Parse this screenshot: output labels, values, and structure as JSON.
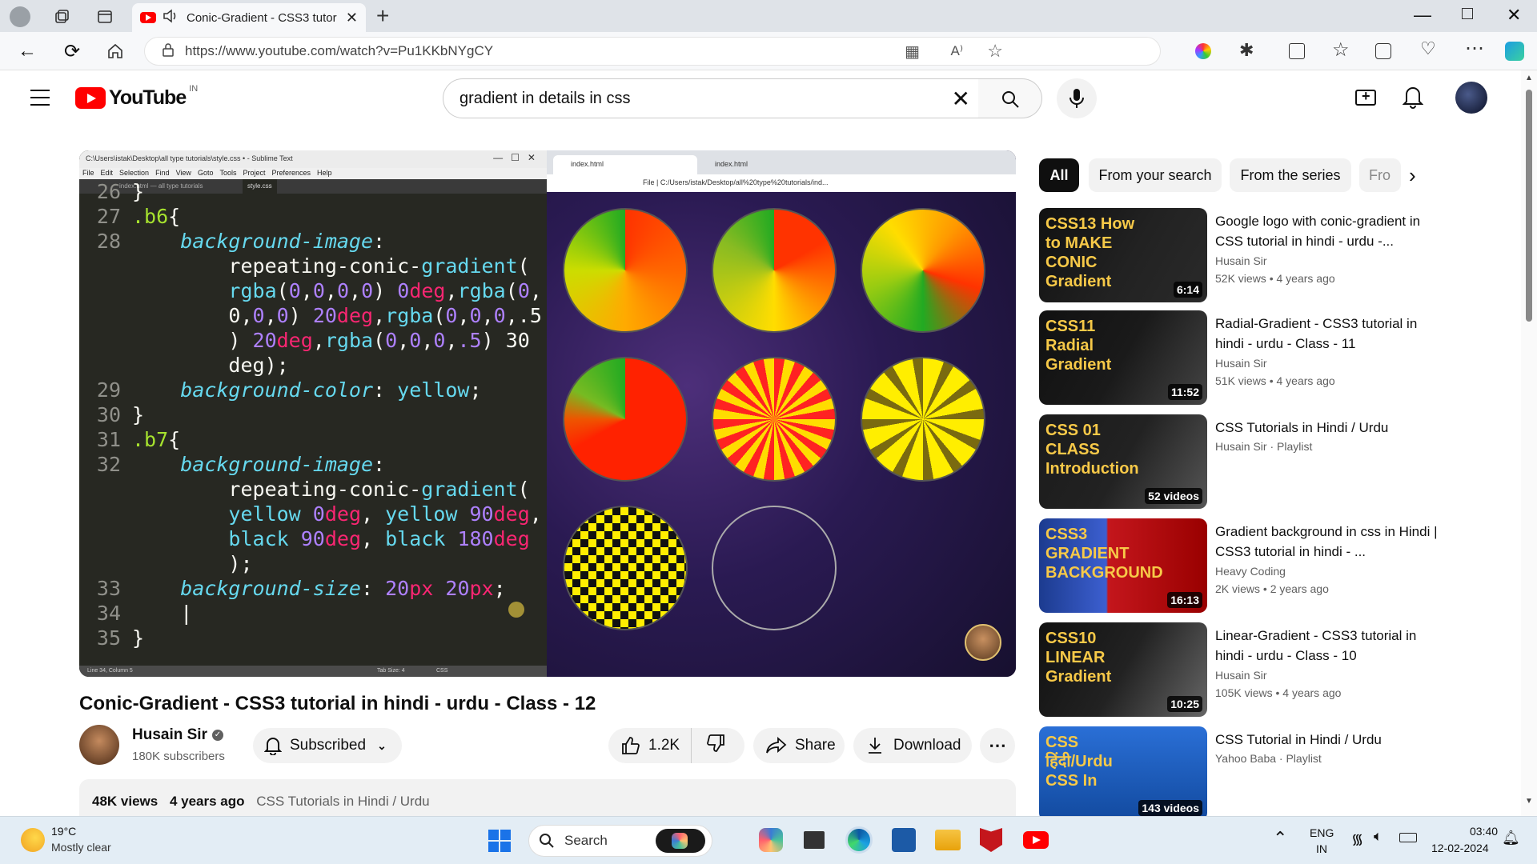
{
  "browser": {
    "tab_title": "Conic-Gradient - CSS3 tutor",
    "url": "https://www.youtube.com/watch?v=Pu1KKbNYgCY"
  },
  "youtube": {
    "logo_text": "YouTube",
    "region": "IN",
    "search_query": "gradient in details in css"
  },
  "editor": {
    "window_title": "C:\\Users\\istak\\Desktop\\all type tutorials\\style.css • - Sublime Text",
    "menu": [
      "File",
      "Edit",
      "Selection",
      "Find",
      "View",
      "Goto",
      "Tools",
      "Project",
      "Preferences",
      "Help"
    ],
    "tabs": [
      "index.html — all type tutorials",
      "style.css"
    ],
    "status_left": "Line 34, Column 5",
    "status_right": "Tab Size: 4",
    "status_lang": "CSS",
    "lines": [
      {
        "n": "26",
        "t": "}"
      },
      {
        "n": "27",
        "t": ".b6{"
      },
      {
        "n": "28",
        "t": "    background-image:"
      },
      {
        "n": "",
        "t": "        repeating-conic-gradient("
      },
      {
        "n": "",
        "t": "        rgba(0,0,0,0) 0deg,rgba(0,"
      },
      {
        "n": "",
        "t": "        0,0,0) 20deg,rgba(0,0,0,.5"
      },
      {
        "n": "",
        "t": "        ) 20deg,rgba(0,0,0,.5) 30"
      },
      {
        "n": "",
        "t": "        deg);"
      },
      {
        "n": "29",
        "t": "    background-color: yellow;"
      },
      {
        "n": "30",
        "t": "}"
      },
      {
        "n": "31",
        "t": ".b7{"
      },
      {
        "n": "32",
        "t": "    background-image:"
      },
      {
        "n": "",
        "t": "        repeating-conic-gradient("
      },
      {
        "n": "",
        "t": "        yellow 0deg, yellow 90deg,"
      },
      {
        "n": "",
        "t": "        black 90deg, black 180deg"
      },
      {
        "n": "",
        "t": "        );"
      },
      {
        "n": "33",
        "t": "    background-size: 20px 20px;"
      },
      {
        "n": "34",
        "t": "    |"
      },
      {
        "n": "35",
        "t": "}"
      }
    ]
  },
  "inner_browser": {
    "tab1": "index.html",
    "tab2": "index.html",
    "url": "C:/Users/istak/Desktop/all%20type%20tutorials/ind...",
    "file_label": "File"
  },
  "video": {
    "title": "Conic-Gradient - CSS3 tutorial in hindi - urdu - Class - 12",
    "channel": "Husain Sir",
    "subscribers": "180K subscribers",
    "subscribe_label": "Subscribed",
    "likes": "1.2K",
    "share_label": "Share",
    "download_label": "Download",
    "views": "48K views",
    "age": "4 years ago",
    "playlist_link": "CSS Tutorials in Hindi / Urdu"
  },
  "chips": [
    "All",
    "From your search",
    "From the series",
    "Fro"
  ],
  "recommendations": [
    {
      "title": "Google logo with conic-gradient in CSS tutorial in hindi - urdu -...",
      "channel": "Husain Sir",
      "meta": "52K views • 4 years ago",
      "duration": "6:14",
      "thumb_text": "CSS13 How to MAKE CONIC Gradient"
    },
    {
      "title": "Radial-Gradient - CSS3 tutorial in hindi - urdu - Class - 11",
      "channel": "Husain Sir",
      "meta": "51K views • 4 years ago",
      "duration": "11:52",
      "thumb_text": "CSS11 Radial Gradient"
    },
    {
      "title": "CSS Tutorials in Hindi / Urdu",
      "channel": "Husain Sir · Playlist",
      "meta": "",
      "duration": "52 videos",
      "thumb_text": "CSS 01 CLASS Introduction"
    },
    {
      "title": "Gradient background in css in Hindi | CSS3 tutorial in hindi - ...",
      "channel": "Heavy Coding",
      "meta": "2K views • 2 years ago",
      "duration": "16:13",
      "thumb_text": "CSS3 GRADIENT BACKGROUND"
    },
    {
      "title": "Linear-Gradient - CSS3 tutorial in hindi - urdu - Class - 10",
      "channel": "Husain Sir",
      "meta": "105K views • 4 years ago",
      "duration": "10:25",
      "thumb_text": "CSS10 LINEAR Gradient"
    },
    {
      "title": "CSS Tutorial in Hindi / Urdu",
      "channel": "Yahoo Baba · Playlist",
      "meta": "",
      "duration": "143 videos",
      "thumb_text": "CSS हिंदी/Urdu CSS In"
    }
  ],
  "taskbar": {
    "temp": "19°C",
    "weather": "Mostly clear",
    "search_label": "Search",
    "lang": "ENG",
    "lang_region": "IN",
    "time": "03:40",
    "date": "12-02-2024"
  },
  "colors": {
    "youtube_red": "#ff0000",
    "editor_bg": "#272822",
    "space_bg": "#2b1e4e"
  }
}
